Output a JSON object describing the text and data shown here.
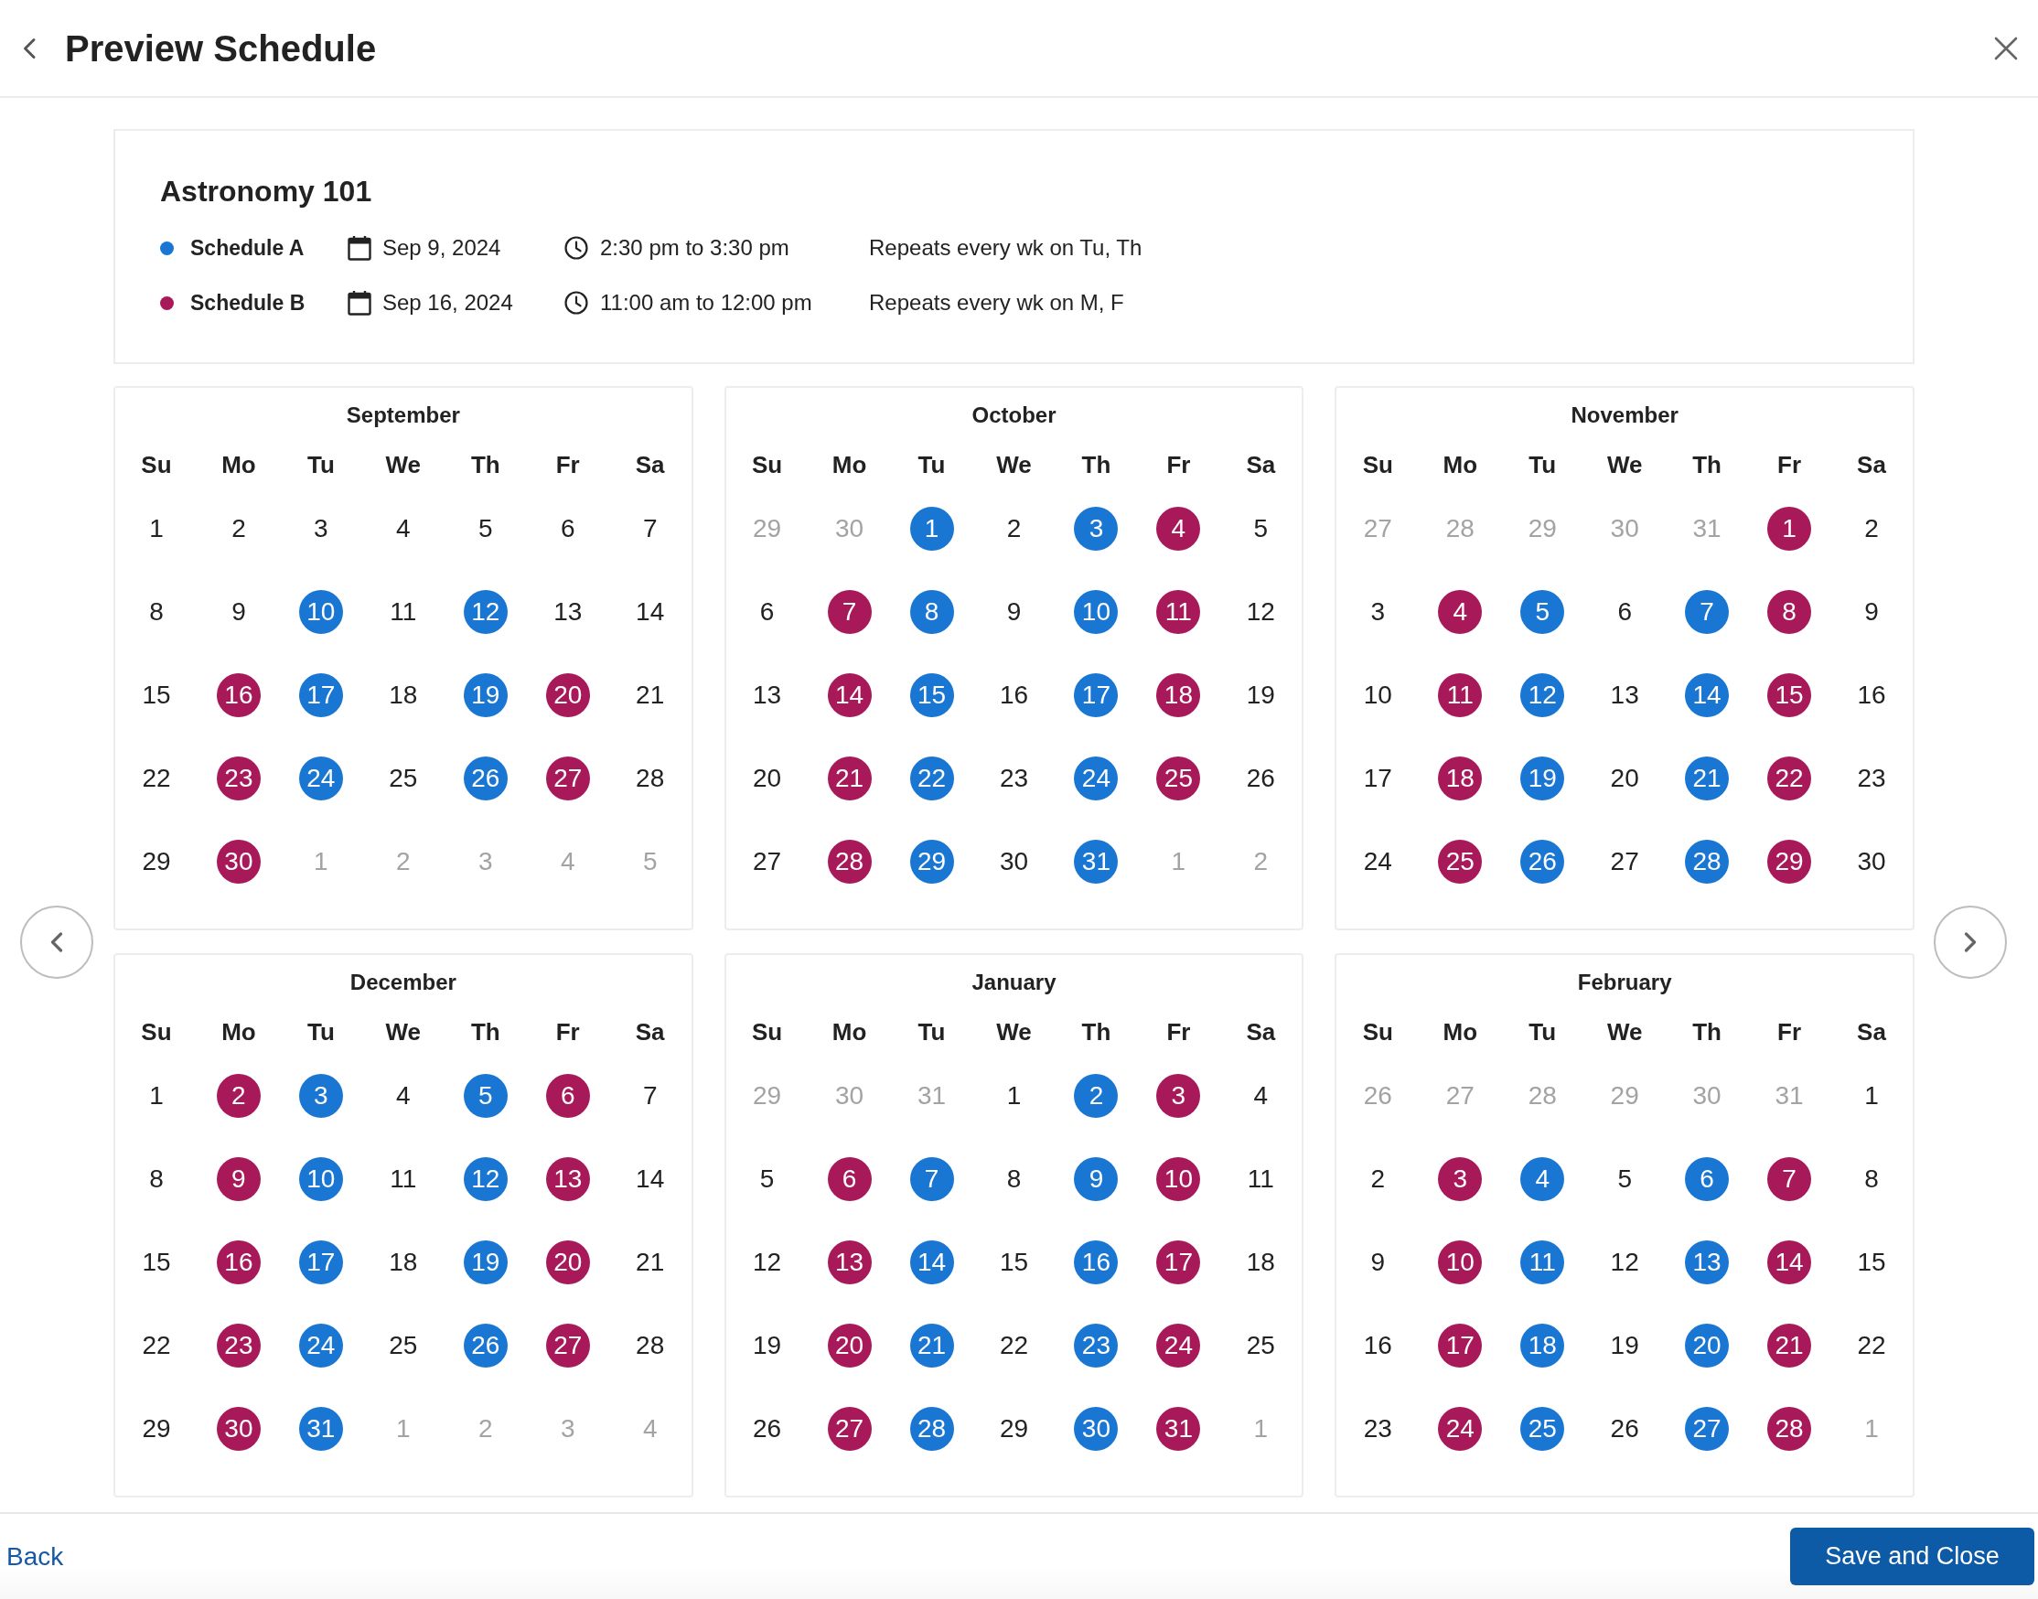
{
  "header": {
    "title": "Preview Schedule"
  },
  "course": {
    "title": "Astronomy 101",
    "schedules": [
      {
        "name": "Schedule A",
        "color": "#1976d2",
        "start_date": "Sep 9, 2024",
        "time": "2:30 pm to 3:30 pm",
        "recurrence": "Repeats every wk on Tu, Th"
      },
      {
        "name": "Schedule B",
        "color": "#a8195a",
        "start_date": "Sep 16, 2024",
        "time": "11:00 am to 12:00 pm",
        "recurrence": "Repeats every wk on M, F"
      }
    ]
  },
  "calendars": [
    {
      "month": "September",
      "weekdays": [
        "Su",
        "Mo",
        "Tu",
        "We",
        "Th",
        "Fr",
        "Sa"
      ],
      "weeks": [
        [
          {
            "label": "1",
            "kind": "day"
          },
          {
            "label": "2",
            "kind": "day"
          },
          {
            "label": "3",
            "kind": "day"
          },
          {
            "label": "4",
            "kind": "day"
          },
          {
            "label": "5",
            "kind": "day"
          },
          {
            "label": "6",
            "kind": "day"
          },
          {
            "label": "7",
            "kind": "day"
          }
        ],
        [
          {
            "label": "8",
            "kind": "day"
          },
          {
            "label": "9",
            "kind": "day"
          },
          {
            "label": "10",
            "kind": "event",
            "color": "#1976d2"
          },
          {
            "label": "11",
            "kind": "day"
          },
          {
            "label": "12",
            "kind": "event",
            "color": "#1976d2"
          },
          {
            "label": "13",
            "kind": "day"
          },
          {
            "label": "14",
            "kind": "day"
          }
        ],
        [
          {
            "label": "15",
            "kind": "day"
          },
          {
            "label": "16",
            "kind": "event",
            "color": "#a8195a"
          },
          {
            "label": "17",
            "kind": "event",
            "color": "#1976d2"
          },
          {
            "label": "18",
            "kind": "day"
          },
          {
            "label": "19",
            "kind": "event",
            "color": "#1976d2"
          },
          {
            "label": "20",
            "kind": "event",
            "color": "#a8195a"
          },
          {
            "label": "21",
            "kind": "day"
          }
        ],
        [
          {
            "label": "22",
            "kind": "day"
          },
          {
            "label": "23",
            "kind": "event",
            "color": "#a8195a"
          },
          {
            "label": "24",
            "kind": "event",
            "color": "#1976d2"
          },
          {
            "label": "25",
            "kind": "day"
          },
          {
            "label": "26",
            "kind": "event",
            "color": "#1976d2"
          },
          {
            "label": "27",
            "kind": "event",
            "color": "#a8195a"
          },
          {
            "label": "28",
            "kind": "day"
          }
        ],
        [
          {
            "label": "29",
            "kind": "day"
          },
          {
            "label": "30",
            "kind": "event",
            "color": "#a8195a"
          },
          {
            "label": "1",
            "kind": "outside"
          },
          {
            "label": "2",
            "kind": "outside"
          },
          {
            "label": "3",
            "kind": "outside"
          },
          {
            "label": "4",
            "kind": "outside"
          },
          {
            "label": "5",
            "kind": "outside"
          }
        ]
      ]
    },
    {
      "month": "October",
      "weekdays": [
        "Su",
        "Mo",
        "Tu",
        "We",
        "Th",
        "Fr",
        "Sa"
      ],
      "weeks": [
        [
          {
            "label": "29",
            "kind": "outside"
          },
          {
            "label": "30",
            "kind": "outside"
          },
          {
            "label": "1",
            "kind": "event",
            "color": "#1976d2"
          },
          {
            "label": "2",
            "kind": "day"
          },
          {
            "label": "3",
            "kind": "event",
            "color": "#1976d2"
          },
          {
            "label": "4",
            "kind": "event",
            "color": "#a8195a"
          },
          {
            "label": "5",
            "kind": "day"
          }
        ],
        [
          {
            "label": "6",
            "kind": "day"
          },
          {
            "label": "7",
            "kind": "event",
            "color": "#a8195a"
          },
          {
            "label": "8",
            "kind": "event",
            "color": "#1976d2"
          },
          {
            "label": "9",
            "kind": "day"
          },
          {
            "label": "10",
            "kind": "event",
            "color": "#1976d2"
          },
          {
            "label": "11",
            "kind": "event",
            "color": "#a8195a"
          },
          {
            "label": "12",
            "kind": "day"
          }
        ],
        [
          {
            "label": "13",
            "kind": "day"
          },
          {
            "label": "14",
            "kind": "event",
            "color": "#a8195a"
          },
          {
            "label": "15",
            "kind": "event",
            "color": "#1976d2"
          },
          {
            "label": "16",
            "kind": "day"
          },
          {
            "label": "17",
            "kind": "event",
            "color": "#1976d2"
          },
          {
            "label": "18",
            "kind": "event",
            "color": "#a8195a"
          },
          {
            "label": "19",
            "kind": "day"
          }
        ],
        [
          {
            "label": "20",
            "kind": "day"
          },
          {
            "label": "21",
            "kind": "event",
            "color": "#a8195a"
          },
          {
            "label": "22",
            "kind": "event",
            "color": "#1976d2"
          },
          {
            "label": "23",
            "kind": "day"
          },
          {
            "label": "24",
            "kind": "event",
            "color": "#1976d2"
          },
          {
            "label": "25",
            "kind": "event",
            "color": "#a8195a"
          },
          {
            "label": "26",
            "kind": "day"
          }
        ],
        [
          {
            "label": "27",
            "kind": "day"
          },
          {
            "label": "28",
            "kind": "event",
            "color": "#a8195a"
          },
          {
            "label": "29",
            "kind": "event",
            "color": "#1976d2"
          },
          {
            "label": "30",
            "kind": "day"
          },
          {
            "label": "31",
            "kind": "event",
            "color": "#1976d2"
          },
          {
            "label": "1",
            "kind": "outside"
          },
          {
            "label": "2",
            "kind": "outside"
          }
        ]
      ]
    },
    {
      "month": "November",
      "weekdays": [
        "Su",
        "Mo",
        "Tu",
        "We",
        "Th",
        "Fr",
        "Sa"
      ],
      "weeks": [
        [
          {
            "label": "27",
            "kind": "outside"
          },
          {
            "label": "28",
            "kind": "outside"
          },
          {
            "label": "29",
            "kind": "outside"
          },
          {
            "label": "30",
            "kind": "outside"
          },
          {
            "label": "31",
            "kind": "outside"
          },
          {
            "label": "1",
            "kind": "event",
            "color": "#a8195a"
          },
          {
            "label": "2",
            "kind": "day"
          }
        ],
        [
          {
            "label": "3",
            "kind": "day"
          },
          {
            "label": "4",
            "kind": "event",
            "color": "#a8195a"
          },
          {
            "label": "5",
            "kind": "event",
            "color": "#1976d2"
          },
          {
            "label": "6",
            "kind": "day"
          },
          {
            "label": "7",
            "kind": "event",
            "color": "#1976d2"
          },
          {
            "label": "8",
            "kind": "event",
            "color": "#a8195a"
          },
          {
            "label": "9",
            "kind": "day"
          }
        ],
        [
          {
            "label": "10",
            "kind": "day"
          },
          {
            "label": "11",
            "kind": "event",
            "color": "#a8195a"
          },
          {
            "label": "12",
            "kind": "event",
            "color": "#1976d2"
          },
          {
            "label": "13",
            "kind": "day"
          },
          {
            "label": "14",
            "kind": "event",
            "color": "#1976d2"
          },
          {
            "label": "15",
            "kind": "event",
            "color": "#a8195a"
          },
          {
            "label": "16",
            "kind": "day"
          }
        ],
        [
          {
            "label": "17",
            "kind": "day"
          },
          {
            "label": "18",
            "kind": "event",
            "color": "#a8195a"
          },
          {
            "label": "19",
            "kind": "event",
            "color": "#1976d2"
          },
          {
            "label": "20",
            "kind": "day"
          },
          {
            "label": "21",
            "kind": "event",
            "color": "#1976d2"
          },
          {
            "label": "22",
            "kind": "event",
            "color": "#a8195a"
          },
          {
            "label": "23",
            "kind": "day"
          }
        ],
        [
          {
            "label": "24",
            "kind": "day"
          },
          {
            "label": "25",
            "kind": "event",
            "color": "#a8195a"
          },
          {
            "label": "26",
            "kind": "event",
            "color": "#1976d2"
          },
          {
            "label": "27",
            "kind": "day"
          },
          {
            "label": "28",
            "kind": "event",
            "color": "#1976d2"
          },
          {
            "label": "29",
            "kind": "event",
            "color": "#a8195a"
          },
          {
            "label": "30",
            "kind": "day"
          }
        ]
      ]
    },
    {
      "month": "December",
      "weekdays": [
        "Su",
        "Mo",
        "Tu",
        "We",
        "Th",
        "Fr",
        "Sa"
      ],
      "weeks": [
        [
          {
            "label": "1",
            "kind": "day"
          },
          {
            "label": "2",
            "kind": "event",
            "color": "#a8195a"
          },
          {
            "label": "3",
            "kind": "event",
            "color": "#1976d2"
          },
          {
            "label": "4",
            "kind": "day"
          },
          {
            "label": "5",
            "kind": "event",
            "color": "#1976d2"
          },
          {
            "label": "6",
            "kind": "event",
            "color": "#a8195a"
          },
          {
            "label": "7",
            "kind": "day"
          }
        ],
        [
          {
            "label": "8",
            "kind": "day"
          },
          {
            "label": "9",
            "kind": "event",
            "color": "#a8195a"
          },
          {
            "label": "10",
            "kind": "event",
            "color": "#1976d2"
          },
          {
            "label": "11",
            "kind": "day"
          },
          {
            "label": "12",
            "kind": "event",
            "color": "#1976d2"
          },
          {
            "label": "13",
            "kind": "event",
            "color": "#a8195a"
          },
          {
            "label": "14",
            "kind": "day"
          }
        ],
        [
          {
            "label": "15",
            "kind": "day"
          },
          {
            "label": "16",
            "kind": "event",
            "color": "#a8195a"
          },
          {
            "label": "17",
            "kind": "event",
            "color": "#1976d2"
          },
          {
            "label": "18",
            "kind": "day"
          },
          {
            "label": "19",
            "kind": "event",
            "color": "#1976d2"
          },
          {
            "label": "20",
            "kind": "event",
            "color": "#a8195a"
          },
          {
            "label": "21",
            "kind": "day"
          }
        ],
        [
          {
            "label": "22",
            "kind": "day"
          },
          {
            "label": "23",
            "kind": "event",
            "color": "#a8195a"
          },
          {
            "label": "24",
            "kind": "event",
            "color": "#1976d2"
          },
          {
            "label": "25",
            "kind": "day"
          },
          {
            "label": "26",
            "kind": "event",
            "color": "#1976d2"
          },
          {
            "label": "27",
            "kind": "event",
            "color": "#a8195a"
          },
          {
            "label": "28",
            "kind": "day"
          }
        ],
        [
          {
            "label": "29",
            "kind": "day"
          },
          {
            "label": "30",
            "kind": "event",
            "color": "#a8195a"
          },
          {
            "label": "31",
            "kind": "event",
            "color": "#1976d2"
          },
          {
            "label": "1",
            "kind": "outside"
          },
          {
            "label": "2",
            "kind": "outside"
          },
          {
            "label": "3",
            "kind": "outside"
          },
          {
            "label": "4",
            "kind": "outside"
          }
        ]
      ]
    },
    {
      "month": "January",
      "weekdays": [
        "Su",
        "Mo",
        "Tu",
        "We",
        "Th",
        "Fr",
        "Sa"
      ],
      "weeks": [
        [
          {
            "label": "29",
            "kind": "outside"
          },
          {
            "label": "30",
            "kind": "outside"
          },
          {
            "label": "31",
            "kind": "outside"
          },
          {
            "label": "1",
            "kind": "day"
          },
          {
            "label": "2",
            "kind": "event",
            "color": "#1976d2"
          },
          {
            "label": "3",
            "kind": "event",
            "color": "#a8195a"
          },
          {
            "label": "4",
            "kind": "day"
          }
        ],
        [
          {
            "label": "5",
            "kind": "day"
          },
          {
            "label": "6",
            "kind": "event",
            "color": "#a8195a"
          },
          {
            "label": "7",
            "kind": "event",
            "color": "#1976d2"
          },
          {
            "label": "8",
            "kind": "day"
          },
          {
            "label": "9",
            "kind": "event",
            "color": "#1976d2"
          },
          {
            "label": "10",
            "kind": "event",
            "color": "#a8195a"
          },
          {
            "label": "11",
            "kind": "day"
          }
        ],
        [
          {
            "label": "12",
            "kind": "day"
          },
          {
            "label": "13",
            "kind": "event",
            "color": "#a8195a"
          },
          {
            "label": "14",
            "kind": "event",
            "color": "#1976d2"
          },
          {
            "label": "15",
            "kind": "day"
          },
          {
            "label": "16",
            "kind": "event",
            "color": "#1976d2"
          },
          {
            "label": "17",
            "kind": "event",
            "color": "#a8195a"
          },
          {
            "label": "18",
            "kind": "day"
          }
        ],
        [
          {
            "label": "19",
            "kind": "day"
          },
          {
            "label": "20",
            "kind": "event",
            "color": "#a8195a"
          },
          {
            "label": "21",
            "kind": "event",
            "color": "#1976d2"
          },
          {
            "label": "22",
            "kind": "day"
          },
          {
            "label": "23",
            "kind": "event",
            "color": "#1976d2"
          },
          {
            "label": "24",
            "kind": "event",
            "color": "#a8195a"
          },
          {
            "label": "25",
            "kind": "day"
          }
        ],
        [
          {
            "label": "26",
            "kind": "day"
          },
          {
            "label": "27",
            "kind": "event",
            "color": "#a8195a"
          },
          {
            "label": "28",
            "kind": "event",
            "color": "#1976d2"
          },
          {
            "label": "29",
            "kind": "day"
          },
          {
            "label": "30",
            "kind": "event",
            "color": "#1976d2"
          },
          {
            "label": "31",
            "kind": "event",
            "color": "#a8195a"
          },
          {
            "label": "1",
            "kind": "outside"
          }
        ]
      ]
    },
    {
      "month": "February",
      "weekdays": [
        "Su",
        "Mo",
        "Tu",
        "We",
        "Th",
        "Fr",
        "Sa"
      ],
      "weeks": [
        [
          {
            "label": "26",
            "kind": "outside"
          },
          {
            "label": "27",
            "kind": "outside"
          },
          {
            "label": "28",
            "kind": "outside"
          },
          {
            "label": "29",
            "kind": "outside"
          },
          {
            "label": "30",
            "kind": "outside"
          },
          {
            "label": "31",
            "kind": "outside"
          },
          {
            "label": "1",
            "kind": "day"
          }
        ],
        [
          {
            "label": "2",
            "kind": "day"
          },
          {
            "label": "3",
            "kind": "event",
            "color": "#a8195a"
          },
          {
            "label": "4",
            "kind": "event",
            "color": "#1976d2"
          },
          {
            "label": "5",
            "kind": "day"
          },
          {
            "label": "6",
            "kind": "event",
            "color": "#1976d2"
          },
          {
            "label": "7",
            "kind": "event",
            "color": "#a8195a"
          },
          {
            "label": "8",
            "kind": "day"
          }
        ],
        [
          {
            "label": "9",
            "kind": "day"
          },
          {
            "label": "10",
            "kind": "event",
            "color": "#a8195a"
          },
          {
            "label": "11",
            "kind": "event",
            "color": "#1976d2"
          },
          {
            "label": "12",
            "kind": "day"
          },
          {
            "label": "13",
            "kind": "event",
            "color": "#1976d2"
          },
          {
            "label": "14",
            "kind": "event",
            "color": "#a8195a"
          },
          {
            "label": "15",
            "kind": "day"
          }
        ],
        [
          {
            "label": "16",
            "kind": "day"
          },
          {
            "label": "17",
            "kind": "event",
            "color": "#a8195a"
          },
          {
            "label": "18",
            "kind": "event",
            "color": "#1976d2"
          },
          {
            "label": "19",
            "kind": "day"
          },
          {
            "label": "20",
            "kind": "event",
            "color": "#1976d2"
          },
          {
            "label": "21",
            "kind": "event",
            "color": "#a8195a"
          },
          {
            "label": "22",
            "kind": "day"
          }
        ],
        [
          {
            "label": "23",
            "kind": "day"
          },
          {
            "label": "24",
            "kind": "event",
            "color": "#a8195a"
          },
          {
            "label": "25",
            "kind": "event",
            "color": "#1976d2"
          },
          {
            "label": "26",
            "kind": "day"
          },
          {
            "label": "27",
            "kind": "event",
            "color": "#1976d2"
          },
          {
            "label": "28",
            "kind": "event",
            "color": "#a8195a"
          },
          {
            "label": "1",
            "kind": "outside"
          }
        ]
      ]
    }
  ],
  "footer": {
    "back_link": "Back",
    "primary_button": "Save and Close"
  }
}
